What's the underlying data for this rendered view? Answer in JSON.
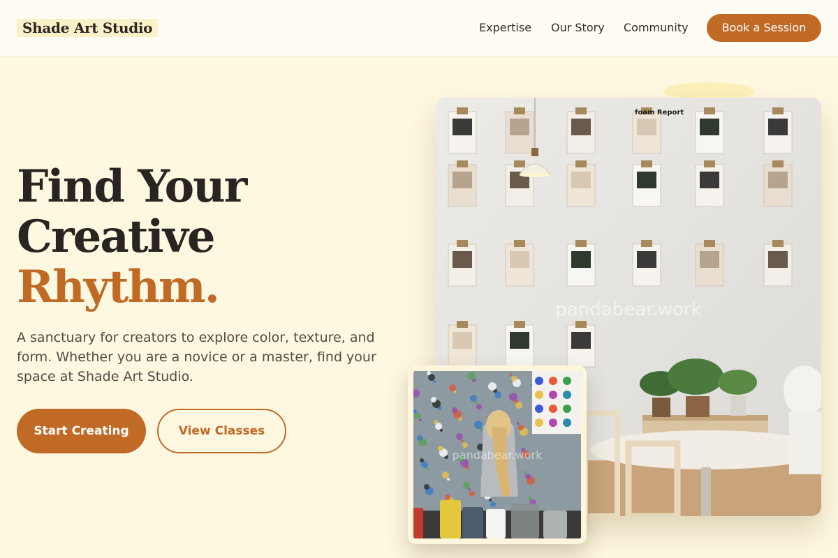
{
  "header": {
    "logo": "Shade Art Studio",
    "nav": [
      "Expertise",
      "Our Story",
      "Community"
    ],
    "cta": "Book a Session"
  },
  "hero": {
    "headline_line1": "Find Your",
    "headline_line2": "Creative",
    "headline_accent": "Rhythm.",
    "subtext": "A sanctuary for creators to explore color, texture, and form. Whether you are a novice or a master, find your space at Shade Art Studio.",
    "primary_button": "Start Creating",
    "secondary_button": "View Classes"
  },
  "images": {
    "main_watermark": "pandabear.work",
    "small_watermark": "pandabear.work",
    "magazine_text": "foam Report"
  },
  "colors": {
    "accent": "#c06a26",
    "background": "#fef8e1",
    "header_bg": "#fffcf3"
  }
}
